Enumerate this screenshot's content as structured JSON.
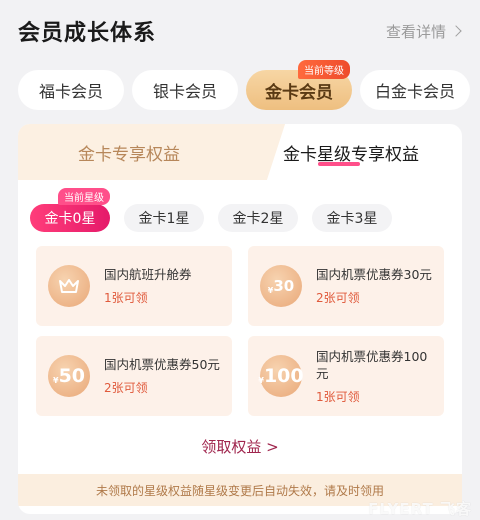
{
  "header": {
    "title": "会员成长体系",
    "details_label": "查看详情"
  },
  "levels": {
    "items": [
      "福卡会员",
      "银卡会员",
      "金卡会员",
      "白金卡会员"
    ],
    "current_badge": "当前等级"
  },
  "card": {
    "tabs": [
      "金卡专享权益",
      "金卡星级专享权益"
    ],
    "stars": {
      "items": [
        "金卡0星",
        "金卡1星",
        "金卡2星",
        "金卡3星"
      ],
      "current_badge": "当前星级"
    },
    "benefits": [
      {
        "icon": "crown-icon",
        "name": "国内航班升舱券",
        "count": "1张可领"
      },
      {
        "icon": "coupon-30-icon",
        "icon_value": "30",
        "name": "国内机票优惠券30元",
        "count": "2张可领"
      },
      {
        "icon": "coupon-50-icon",
        "icon_value": "50",
        "name": "国内机票优惠券50元",
        "count": "2张可领"
      },
      {
        "icon": "coupon-100-icon",
        "icon_value": "100",
        "name": "国内机票优惠券100元",
        "count": "1张可领"
      }
    ],
    "claim_label": "领取权益 >",
    "footer_note": "未领取的星级权益随星级变更后自动失效，请及时领用"
  },
  "watermark": "FLYERT 飞客"
}
